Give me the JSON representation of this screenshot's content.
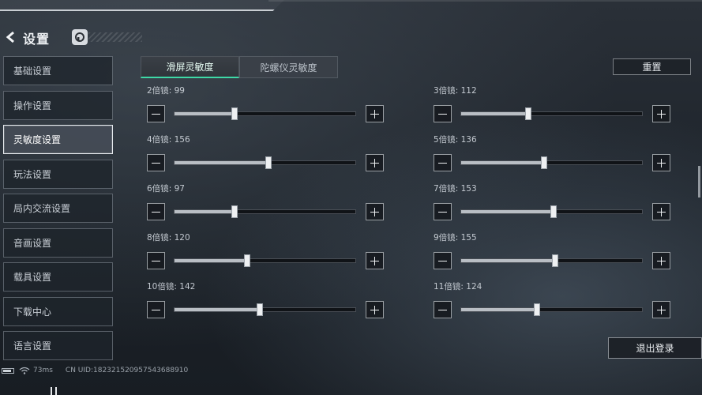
{
  "header": {
    "title": "设置"
  },
  "sidebar": {
    "items": [
      {
        "label": "基础设置",
        "active": false
      },
      {
        "label": "操作设置",
        "active": false
      },
      {
        "label": "灵敏度设置",
        "active": true
      },
      {
        "label": "玩法设置",
        "active": false
      },
      {
        "label": "局内交流设置",
        "active": false
      },
      {
        "label": "音画设置",
        "active": false
      },
      {
        "label": "载具设置",
        "active": false
      },
      {
        "label": "下载中心",
        "active": false
      },
      {
        "label": "语言设置",
        "active": false
      }
    ]
  },
  "tabs": [
    {
      "label": "滑屏灵敏度",
      "active": true
    },
    {
      "label": "陀螺仪灵敏度",
      "active": false
    }
  ],
  "reset_label": "重置",
  "sliders": [
    {
      "name": "2倍镜",
      "value": "99",
      "fraction": 0.33
    },
    {
      "name": "3倍镜",
      "value": "112",
      "fraction": 0.37
    },
    {
      "name": "4倍镜",
      "value": "156",
      "fraction": 0.52
    },
    {
      "name": "5倍镜",
      "value": "136",
      "fraction": 0.46
    },
    {
      "name": "6倍镜",
      "value": "97",
      "fraction": 0.33
    },
    {
      "name": "7倍镜",
      "value": "153",
      "fraction": 0.51
    },
    {
      "name": "8倍镜",
      "value": "120",
      "fraction": 0.4
    },
    {
      "name": "9倍镜",
      "value": "155",
      "fraction": 0.52
    },
    {
      "name": "10倍镜",
      "value": "142",
      "fraction": 0.47
    },
    {
      "name": "11倍镜",
      "value": "124",
      "fraction": 0.42
    }
  ],
  "slider_separator": ": ",
  "logout_label": "退出登录",
  "status": {
    "ping": "73ms",
    "uid": "CN UID:1823215209575436889​10"
  },
  "icons": {
    "back": "chevron-left-icon",
    "help": "headset-icon",
    "battery": "battery-icon",
    "wifi": "wifi-icon"
  },
  "colors": {
    "accent": "#3ed9a6"
  }
}
